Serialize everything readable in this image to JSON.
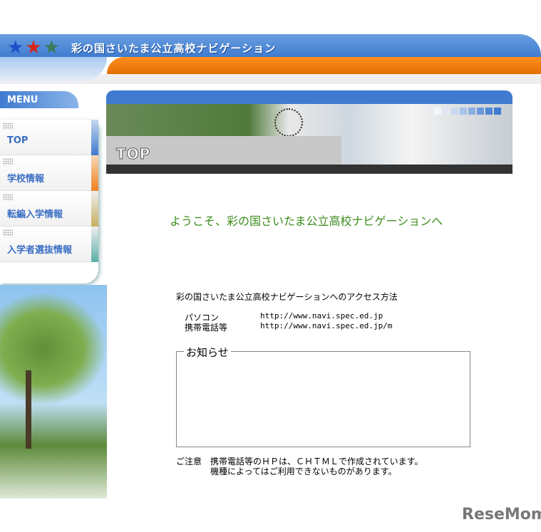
{
  "header": {
    "title": "彩の国さいたま公立高校ナビゲーション",
    "stars": [
      "#1f4fc8",
      "#d42a1e",
      "#3c7a5a"
    ]
  },
  "menu": {
    "label": "MENU",
    "items": [
      {
        "label": "TOP",
        "color": "#3f7bd0"
      },
      {
        "label": "学校情報",
        "color": "#f08020"
      },
      {
        "label": "転編入学情報",
        "color": "#c8b060"
      },
      {
        "label": "入学者選抜情報",
        "color": "#5ab0a8"
      }
    ]
  },
  "banner": {
    "title": "TOP"
  },
  "main": {
    "welcome": "ようこそ、彩の国さいたま公立高校ナビゲーションへ",
    "access_title": "彩の国さいたま公立高校ナビゲーションへのアクセス方法",
    "access": [
      {
        "label": "パソコン",
        "url": "http://www.navi.spec.ed.jp"
      },
      {
        "label": "携帯電話等",
        "url": "http://www.navi.spec.ed.jp/m"
      }
    ],
    "news_title": "お知らせ",
    "note_label": "ご注意",
    "note_line1": "携帯電話等のＨＰは、ＣＨＴＭＬで作成されています。",
    "note_line2": "機種によってはご利用できないものがあります。"
  },
  "watermark": "ReseMom"
}
